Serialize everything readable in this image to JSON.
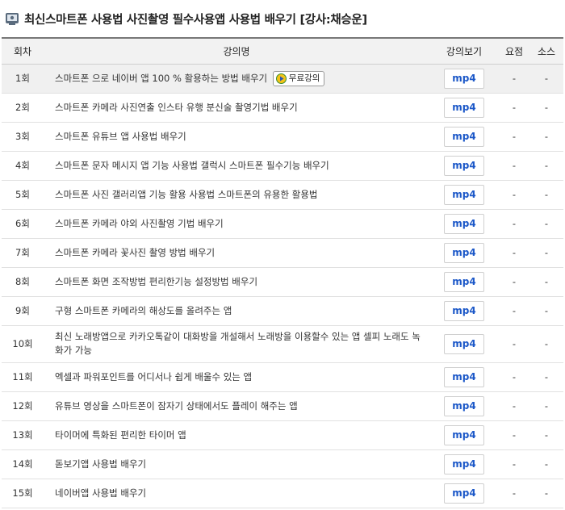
{
  "header": {
    "title": "최신스마트폰 사용법 사진촬영 필수사용앱 사용법 배우기 [강사:채승운]"
  },
  "columns": {
    "no": "회차",
    "title": "강의명",
    "view": "강의보기",
    "summary": "요점",
    "source": "소스"
  },
  "free_label": "무료강의",
  "rows": [
    {
      "no": "1회",
      "title": "스마트폰 으로 네이버 앱 100 % 활용하는 방법 배우기",
      "view": "mp4",
      "summary": "-",
      "source": "-"
    },
    {
      "no": "2회",
      "title": "스마트폰 카메라 사진연출 인스타 유행 분신술 촬영기법 배우기",
      "view": "mp4",
      "summary": "-",
      "source": "-"
    },
    {
      "no": "3회",
      "title": "스마트폰 유튜브 앱 사용법 배우기",
      "view": "mp4",
      "summary": "-",
      "source": "-"
    },
    {
      "no": "4회",
      "title": "스마트폰 문자 메시지 앱 기능 사용법 갤럭시 스마트폰 필수기능 배우기",
      "view": "mp4",
      "summary": "-",
      "source": "-"
    },
    {
      "no": "5회",
      "title": "스마트폰 사진 갤러리앱 기능 활용 사용법 스마트폰의 유용한 활용법",
      "view": "mp4",
      "summary": "-",
      "source": "-"
    },
    {
      "no": "6회",
      "title": "스마트폰 카메라 야외 사진촬영 기법 배우기",
      "view": "mp4",
      "summary": "-",
      "source": "-"
    },
    {
      "no": "7회",
      "title": "스마트폰 카메라 꽃사진 촬영 방법 배우기",
      "view": "mp4",
      "summary": "-",
      "source": "-"
    },
    {
      "no": "8회",
      "title": "스마트폰 화면 조작방법 편리한기능 설정방법 배우기",
      "view": "mp4",
      "summary": "-",
      "source": "-"
    },
    {
      "no": "9회",
      "title": "구형 스마트폰 카메라의 해상도를 올려주는 앱",
      "view": "mp4",
      "summary": "-",
      "source": "-"
    },
    {
      "no": "10회",
      "title": "최신 노래방앱으로 카카오톡같이 대화방을 개설해서 노래방을 이용할수 있는 앱 셀피 노래도 녹화가 가능",
      "view": "mp4",
      "summary": "-",
      "source": "-"
    },
    {
      "no": "11회",
      "title": "엑셀과 파워포인트를 어디서나 쉽게 배울수 있는 앱",
      "view": "mp4",
      "summary": "-",
      "source": "-"
    },
    {
      "no": "12회",
      "title": "유튜브 영상을 스마트폰이 잠자기 상태에서도 플레이 해주는 앱",
      "view": "mp4",
      "summary": "-",
      "source": "-"
    },
    {
      "no": "13회",
      "title": "타이머에 특화된 편리한 타이머 앱",
      "view": "mp4",
      "summary": "-",
      "source": "-"
    },
    {
      "no": "14회",
      "title": "돋보기앱 사용법 배우기",
      "view": "mp4",
      "summary": "-",
      "source": "-"
    },
    {
      "no": "15회",
      "title": "네이버앱 사용법 배우기",
      "view": "mp4",
      "summary": "-",
      "source": "-"
    }
  ],
  "colors": {
    "mp4_text": "#1c58c8",
    "header_bg": "#f2f2f2",
    "highlight_row": "#f0f0f0"
  },
  "icons": {
    "title": "course-book-icon",
    "free": "play-icon"
  }
}
